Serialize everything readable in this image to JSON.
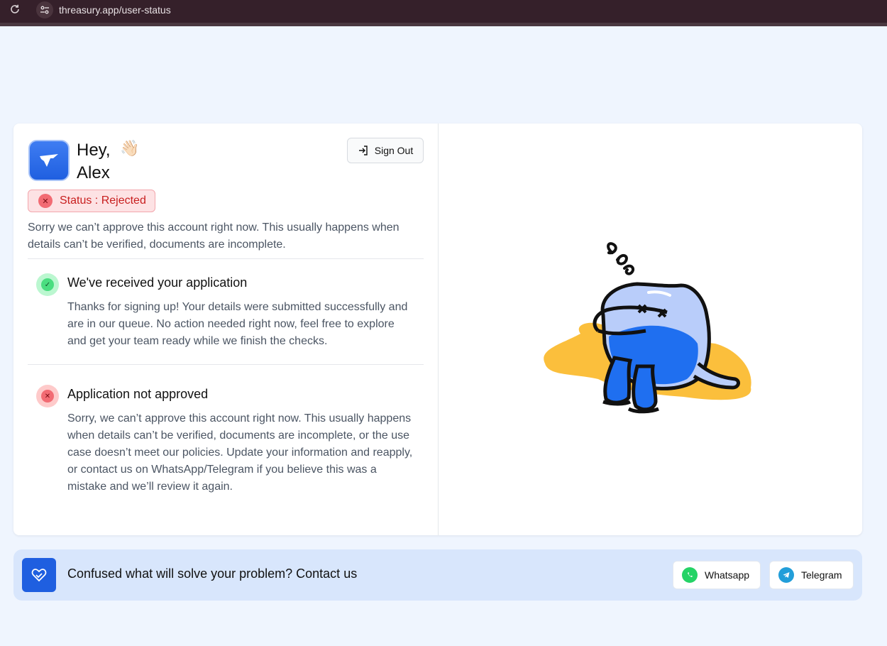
{
  "browser": {
    "url": "threasury.app/user-status"
  },
  "header": {
    "greeting_line1": "Hey,",
    "greeting_line2": "Alex",
    "wave_emoji": "👋🏻",
    "signout_label": "Sign Out"
  },
  "status": {
    "label": "Status : Rejected",
    "color": "#c81e1e"
  },
  "intro_text": "Sorry we can’t approve this account right now. This usually happens when details can’t be verified, documents are incomplete.",
  "steps": [
    {
      "title": "We've received your application",
      "description": "Thanks for signing up! Your details were submitted successfully and are in our queue. No action needed right now, feel free to explore and get your team ready while we finish the checks.",
      "state": "success",
      "icon": "check-icon"
    },
    {
      "title": "Application not approved",
      "description": "Sorry, we can’t approve this account right now. This usually happens when details can’t be verified, documents are incomplete, or the use case doesn’t meet our policies. Update your information and reapply, or contact us on WhatsApp/Telegram if you believe this was a mistake and we’ll review it again.",
      "state": "rejected",
      "icon": "x-icon"
    }
  ],
  "contact": {
    "text": "Confused what will solve your problem? Contact us",
    "whatsapp_label": "Whatsapp",
    "telegram_label": "Telegram"
  },
  "colors": {
    "brand_blue": "#1f5fe0",
    "success_green": "#22c55e",
    "error_red": "#ef4444",
    "whatsapp_green": "#25d366",
    "telegram_blue": "#229ed9"
  }
}
